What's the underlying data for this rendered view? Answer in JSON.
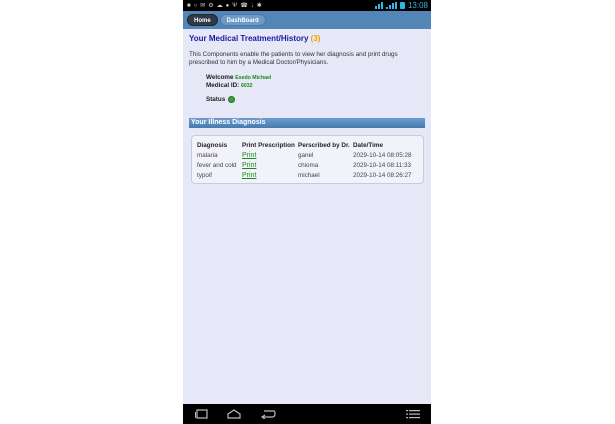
{
  "statusbar": {
    "notification_icons": [
      "chat-icon",
      "whatsapp-icon",
      "message-icon",
      "settings-icon",
      "cloud-icon",
      "location-icon",
      "usb-icon",
      "phone-icon",
      "download-icon",
      "bluetooth-icon"
    ],
    "time": "13:08",
    "accent_color": "#33b5e5"
  },
  "nav": {
    "home_label": "Home",
    "dashboard_label": "DashBoard"
  },
  "page": {
    "title": "Your Medical Treatment/History",
    "count_open": "(",
    "count": "(3)",
    "count_close": ")",
    "intro": "This Components enable the patients to view her diagnosis and print drugs prescribed to him by a Medical Doctor/Physicians."
  },
  "patient": {
    "welcome_label": "Welcome",
    "name": "Esedo Michael",
    "medical_id_label": "Medical ID:",
    "medical_id": "6032",
    "status_label": "Status"
  },
  "diagnosis": {
    "section_title": "Your Illness Diagnosis",
    "columns": [
      "Diagnosis",
      "Print Prescription",
      "Perscribed by Dr.",
      "Date/Time"
    ],
    "rows": [
      {
        "diagnosis": "malaria",
        "print": "Print",
        "doctor": "ganel",
        "datetime": "2029-10-14 08:05:28"
      },
      {
        "diagnosis": "fever and cold",
        "print": "Print",
        "doctor": "chioma",
        "datetime": "2029-10-14 08:11:33"
      },
      {
        "diagnosis": "typoif",
        "print": "Print",
        "doctor": "michael",
        "datetime": "2029-10-14 08:26:27"
      }
    ]
  }
}
